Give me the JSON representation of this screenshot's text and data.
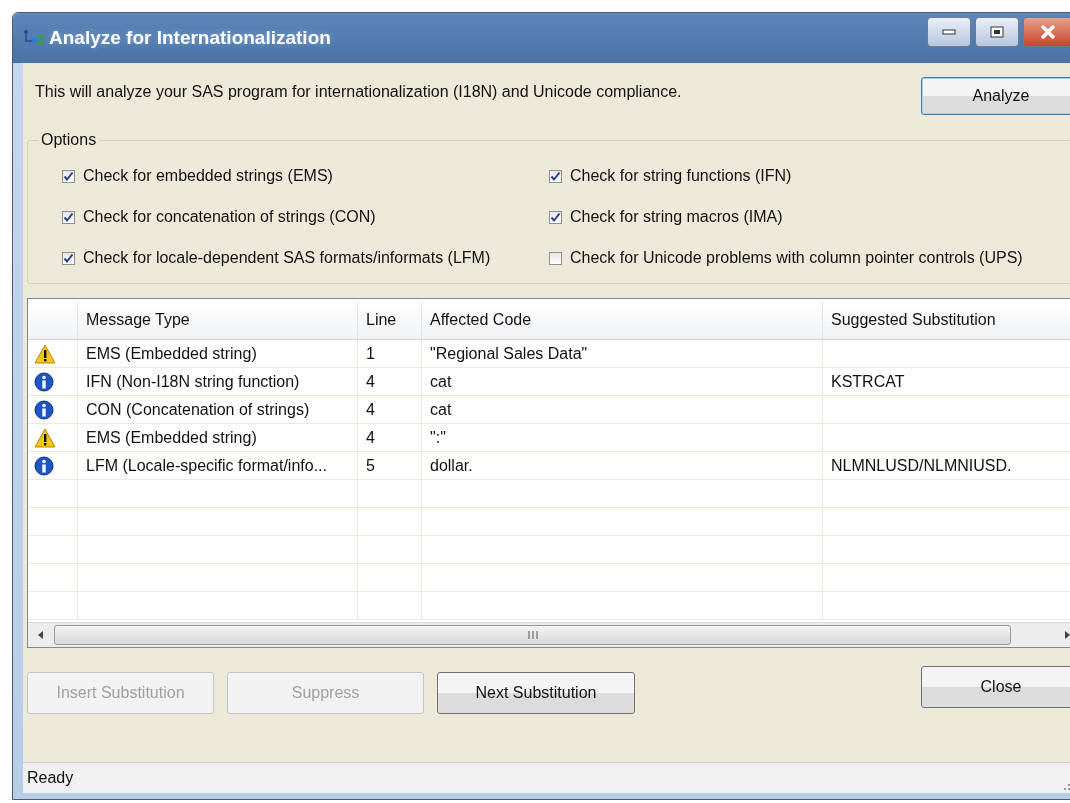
{
  "window": {
    "title": "Analyze for Internationalization"
  },
  "description": "This will analyze your SAS program for internationalization (I18N) and Unicode compliance.",
  "analyze_button": {
    "label": "Analyze",
    "disabled": false
  },
  "options": {
    "title": "Options",
    "checkboxes": [
      {
        "label": "Check for embedded strings (EMS)",
        "checked": true
      },
      {
        "label": "Check for string functions (IFN)",
        "checked": true
      },
      {
        "label": "Check for concatenation of strings (CON)",
        "checked": true
      },
      {
        "label": "Check for string macros (IMA)",
        "checked": true
      },
      {
        "label": "Check for locale-dependent SAS formats/informats  (LFM)",
        "checked": true
      },
      {
        "label": "Check for Unicode problems with column pointer controls (UPS)",
        "checked": false
      }
    ]
  },
  "table": {
    "columns": [
      "Message Type",
      "Line",
      "Affected Code",
      "Suggested Substitution"
    ],
    "rows": [
      {
        "kind": "warning",
        "message_type": "EMS (Embedded string)",
        "line": "1",
        "affected_code": "\"Regional Sales Data\"",
        "suggested_substitution": ""
      },
      {
        "kind": "info",
        "message_type": "IFN (Non-I18N string function)",
        "line": "4",
        "affected_code": "cat",
        "suggested_substitution": "KSTRCAT"
      },
      {
        "kind": "info",
        "message_type": "CON (Concatenation of strings)",
        "line": "4",
        "affected_code": "cat",
        "suggested_substitution": ""
      },
      {
        "kind": "warning",
        "message_type": "EMS (Embedded string)",
        "line": "4",
        "affected_code": "\":\"",
        "suggested_substitution": ""
      },
      {
        "kind": "info",
        "message_type": "LFM (Locale-specific format/info...",
        "line": "5",
        "affected_code": "dollar.",
        "suggested_substitution": "NLMNLUSD/NLMNIUSD."
      }
    ]
  },
  "buttons": [
    {
      "label": "Insert Substitution",
      "disabled": true
    },
    {
      "label": "Suppress",
      "disabled": true
    },
    {
      "label": "Next Substitution",
      "disabled": false
    }
  ],
  "close_button": {
    "label": "Close",
    "disabled": false
  },
  "status_bar": "Ready"
}
